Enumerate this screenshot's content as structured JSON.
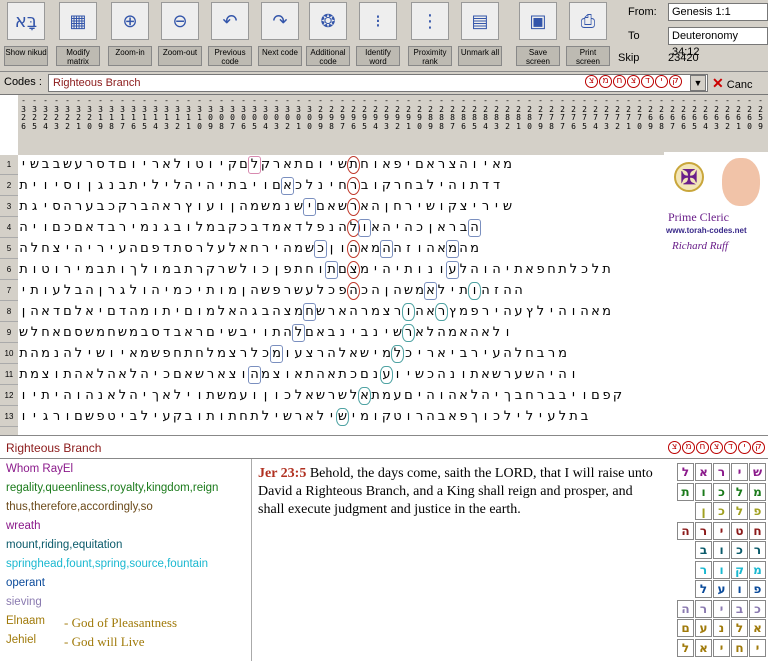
{
  "toolbar": {
    "buttons": [
      {
        "label": "Show nikud",
        "glyph": "בָּא"
      },
      {
        "label": "Modify matrix",
        "glyph": "▦"
      },
      {
        "label": "Zoom-in",
        "glyph": "⊕"
      },
      {
        "label": "Zoom-out",
        "glyph": "⊖"
      },
      {
        "label": "Previous code",
        "glyph": "↶"
      },
      {
        "label": "Next code",
        "glyph": "↷"
      },
      {
        "label": "Additional code",
        "glyph": "❂"
      },
      {
        "label": "Identify word",
        "glyph": "⁝"
      },
      {
        "label": "Proximity rank",
        "glyph": "⋮"
      },
      {
        "label": "Unmark all",
        "glyph": "▤"
      },
      {
        "label": "Save screen",
        "glyph": "▣"
      },
      {
        "label": "Print screen",
        "glyph": "⎙"
      }
    ],
    "from_label": "From:",
    "from_value": "Genesis 1:1",
    "to_label": "To",
    "to_value": "Deuteronomy 34:12",
    "skip_label": "Skip",
    "skip_value": "23420"
  },
  "codes": {
    "label": "Codes :",
    "value": "Righteous Branch",
    "hebrew": [
      "צ",
      "מ",
      "ח",
      "צ",
      "ד",
      "י",
      "ק"
    ],
    "cancel_label": "Canc"
  },
  "matrix": {
    "columns": [
      "-326",
      "-325",
      "-324",
      "-323",
      "-322",
      "-321",
      "-320",
      "-319",
      "-318",
      "-317",
      "-316",
      "-315",
      "-314",
      "-313",
      "-312",
      "-311",
      "-310",
      "-309",
      "-308",
      "-307",
      "-306",
      "-305",
      "-304",
      "-303",
      "-302",
      "-301",
      "-300",
      "-299",
      "-298",
      "-297",
      "-296",
      "-295",
      "-294",
      "-293",
      "-292",
      "-291",
      "-290",
      "-289",
      "-288",
      "-287",
      "-286",
      "-285",
      "-284",
      "-283",
      "-282",
      "-281",
      "-280",
      "-279",
      "-278",
      "-277",
      "-276",
      "-275",
      "-274",
      "-273",
      "-272",
      "-271",
      "-270",
      "-269",
      "-268",
      "-267",
      "-266",
      "-265",
      "-264",
      "-263",
      "-262",
      "-261",
      "-260",
      "-259"
    ],
    "rows": [
      "ישבבשערסדםויראלוטויקםלקראתםוישתחואפיםארצהויאמ",
      "תיויסוןגנבתילילהיהיתביוםאכלנ יחרבוקרחבליהותדד",
      "תגיסהרעבכקרבהארץועוןהמשמ נשיםאשראהןחרישוקציריש",
      "היוםכםאדברימנגבולמבקכבדמאדלפנהלואהיהכןארבה",
      "הלחציהיריעהםפדתסרלעלאחריהמשכןוהאמההזוהאמהמ",
      "תוטורימבתוךלומבתרקרשלוכןפתחותםצמיהיתונועלהוהיתאפחתלכלת",
      "יתועלבהןרגלוהימכיתומןהשפרשעלכפהכהןהשמאליתוהזהה",
      "ןהאדםלאיםדהמותיםומלאהגבהצמחשראהרמצרוהארץמפריהעץליהוהאמ",
      "שלחאםסשמחשמבסדבארםישביותהלםאבניבנישראלהמאהאלו",
      "תהמנהלישויאמשפחתחלמצרלכמועצרהלאשימלכיראיבריעהלחברמ",
      "תמצותהאלהאלהיכםאשראצוהמצואתהאתכםנעוישכהנותאשרעשהיהו",
      "ויתיהוהנאלהיךאליותשמעוןוכלאשרשלאתמעםיהוהאלהיךבחרבביוםפק",
      "ויגרוםשפטיבליעקבותותחתלישראלישימוקטורהבאפךוכליליעלתב"
    ],
    "row_numbers": [
      "1",
      "2",
      "3",
      "4",
      "5",
      "6",
      "7",
      "8",
      "9",
      "10",
      "11",
      "12",
      "13"
    ]
  },
  "logo": {
    "title": "Prime Cleric",
    "url": "www.torah-codes.net",
    "signature": "Richard Ruff"
  },
  "found": {
    "label": "Righteous Branch",
    "hebrew": [
      "צ",
      "מ",
      "ח",
      "צ",
      "ד",
      "י",
      "ק"
    ]
  },
  "terms": [
    {
      "text": "Whom RayEl",
      "color": "#8b1a8b"
    },
    {
      "text": "regality,queenliness,royalty,kingdom,reign",
      "color": "#1a7a1a"
    },
    {
      "text": "thus,therefore,accordingly,so",
      "color": "#6b4a1a"
    },
    {
      "text": "wreath",
      "color": "#8b1a8b"
    },
    {
      "text": "mount,riding,equitation",
      "color": "#0a5a6a"
    },
    {
      "text": "springhead,fount,spring,source,fountain",
      "color": "#1ab8d0"
    },
    {
      "text": "operant",
      "color": "#0a4a9a"
    },
    {
      "text": "sieving",
      "color": "#8a7ab0"
    },
    {
      "text": "Elnaam",
      "color": "#a07a0a",
      "meaning": "- God of Pleasantness"
    },
    {
      "text": "Jehiel",
      "color": "#a07a0a",
      "meaning": "- God will Live"
    }
  ],
  "verse": {
    "ref": "Jer 23:5",
    "text": "Behold, the days come, saith the LORD, that I will raise unto David a Righteous Branch, and a King shall reign and prosper, and shall execute judgment and justice in the earth."
  },
  "mini_grid": [
    {
      "letters": [
        "ל",
        "א",
        "ר",
        "י",
        "ש"
      ],
      "color": "#8b1a8b"
    },
    {
      "letters": [
        "ת",
        "ו",
        "כ",
        "ל",
        "מ"
      ],
      "color": "#1a7a1a"
    },
    {
      "letters": [
        "ן",
        "כ",
        "ל",
        "פ"
      ],
      "color": "#a0a020"
    },
    {
      "letters": [
        "ה",
        "ר",
        "י",
        "ט",
        "ח"
      ],
      "color": "#8b1a1a"
    },
    {
      "letters": [
        "ב",
        "ו",
        "כ",
        "ר"
      ],
      "color": "#0a5a6a"
    },
    {
      "letters": [
        "ר",
        "ו",
        "ק",
        "מ"
      ],
      "color": "#1ab8d0"
    },
    {
      "letters": [
        "ל",
        "ע",
        "ו",
        "פ"
      ],
      "color": "#0a4a9a"
    },
    {
      "letters": [
        "ה",
        "ר",
        "י",
        "ב",
        "כ"
      ],
      "color": "#8a7ab0"
    },
    {
      "letters": [
        "ם",
        "ע",
        "נ",
        "ל",
        "א"
      ],
      "color": "#a07a0a"
    },
    {
      "letters": [
        "ל",
        "א",
        "י",
        "ח",
        "י"
      ],
      "color": "#a07a0a"
    }
  ]
}
